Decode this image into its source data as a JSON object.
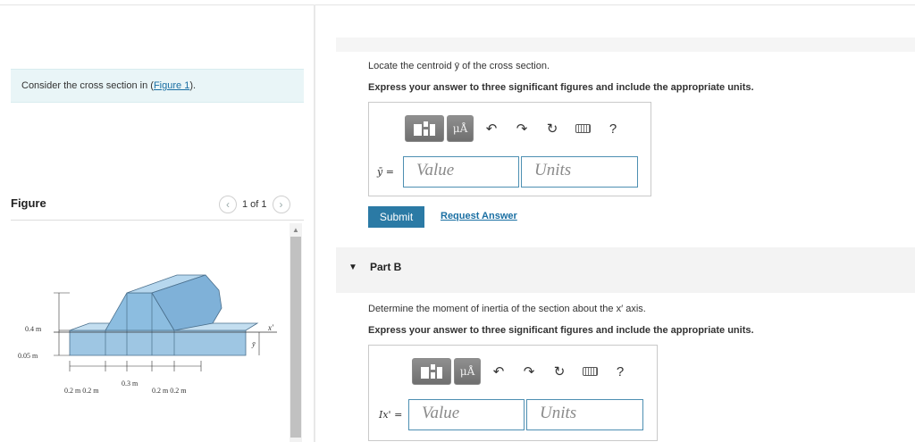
{
  "left": {
    "consider_text": "Consider the cross section in (",
    "figure_link": "Figure 1",
    "consider_tail": ").",
    "figure_heading": "Figure",
    "pager_text": "1 of 1",
    "figure": {
      "dim_04": "0.4 m",
      "dim_005": "0.05 m",
      "dim_03": "0.3 m",
      "dim_left": "0.2 m 0.2 m",
      "dim_right": "0.2 m 0.2 m",
      "axis_x": "x'",
      "axis_y": "ȳ",
      "fill_color": "#9ec6e3"
    }
  },
  "partA": {
    "question": "Locate the centroid ȳ of the cross section.",
    "instruction": "Express your answer to three significant figures and include the appropriate units.",
    "mu_label": "μÅ",
    "help_label": "?",
    "symbol": "ȳ =",
    "value_placeholder": "Value",
    "units_placeholder": "Units",
    "submit_label": "Submit",
    "request_label": "Request Answer"
  },
  "partB": {
    "title": "Part B",
    "question": "Determine the moment of inertia of the section about the x′ axis.",
    "instruction": "Express your answer to three significant figures and include the appropriate units.",
    "mu_label": "μÅ",
    "help_label": "?",
    "symbol": "Ix' =",
    "value_placeholder": "Value",
    "units_placeholder": "Units"
  },
  "colors": {
    "accent": "#2b7aa5",
    "input_border": "#4d8fb2",
    "link": "#1a6fa3"
  }
}
